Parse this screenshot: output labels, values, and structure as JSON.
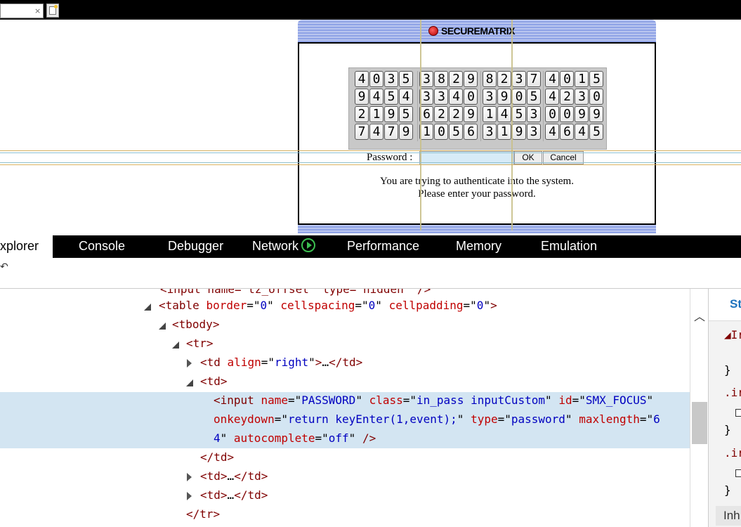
{
  "browser": {
    "close_glyph": "×",
    "newtab_icon": "new-tab-icon"
  },
  "smx": {
    "brand": "SECUREMATRIX",
    "grid": [
      [
        [
          "4",
          "0",
          "3",
          "5"
        ],
        [
          "3",
          "8",
          "2",
          "9"
        ],
        [
          "8",
          "2",
          "3",
          "7"
        ],
        [
          "4",
          "0",
          "1",
          "5"
        ]
      ],
      [
        [
          "9",
          "4",
          "5",
          "4"
        ],
        [
          "3",
          "3",
          "4",
          "0"
        ],
        [
          "3",
          "9",
          "0",
          "5"
        ],
        [
          "4",
          "2",
          "3",
          "0"
        ]
      ],
      [
        [
          "2",
          "1",
          "9",
          "5"
        ],
        [
          "6",
          "2",
          "2",
          "9"
        ],
        [
          "1",
          "4",
          "5",
          "3"
        ],
        [
          "0",
          "0",
          "9",
          "9"
        ]
      ],
      [
        [
          "7",
          "4",
          "7",
          "9"
        ],
        [
          "1",
          "0",
          "5",
          "6"
        ],
        [
          "3",
          "1",
          "9",
          "3"
        ],
        [
          "4",
          "6",
          "4",
          "5"
        ]
      ]
    ],
    "password_label": "Password :",
    "ok_label": "OK",
    "cancel_label": "Cancel",
    "message_line1": "You are trying to authenticate into the system.",
    "message_line2": "Please enter your password."
  },
  "devtools": {
    "tabs": [
      "xplorer",
      "Console",
      "Debugger",
      "Network",
      "Performance",
      "Memory",
      "Emulation"
    ],
    "toolbar_glyph": "↶"
  },
  "dom": {
    "line0": "<input name=\"tz_offset\" type=\"hidden\" />",
    "table_tag": "table",
    "table_attrs": [
      {
        "name": "border",
        "value": "0"
      },
      {
        "name": "cellspacing",
        "value": "0"
      },
      {
        "name": "cellpadding",
        "value": "0"
      }
    ],
    "tbody": "tbody",
    "tr": "tr",
    "td_align_name": "align",
    "td_align_value": "right",
    "ellipsis": "…",
    "td": "td",
    "input_tag": "input",
    "input_attrs": {
      "name": "PASSWORD",
      "class": "in_pass inputCustom",
      "id": "SMX_FOCUS",
      "onkeydown": "return keyEnter(1,event);",
      "type": "password",
      "maxlength_part1": "6",
      "maxlength_part2": "4",
      "autocomplete": "off"
    }
  },
  "styles_pane": {
    "tab_label": "St",
    "rule1": "◢Ir",
    "brace": "}",
    "rule2": ".ir",
    "rule3": ".ir",
    "inherited": "Inh"
  }
}
